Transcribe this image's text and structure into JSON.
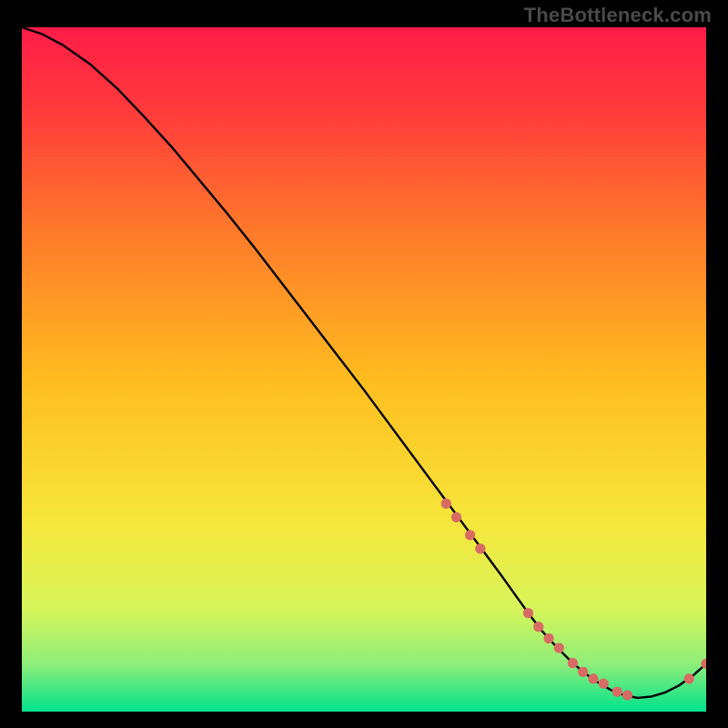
{
  "watermark": {
    "text": "TheBottleneck.com"
  },
  "chart_data": {
    "type": "line",
    "title": "",
    "xlabel": "",
    "ylabel": "",
    "xlim": [
      0,
      100
    ],
    "ylim": [
      0,
      100
    ],
    "grid": false,
    "legend": false,
    "background_gradient": {
      "top_color": "#ff1c48",
      "mid_color": "#ffbe1f",
      "bottom_color": "#00e28c"
    },
    "series": [
      {
        "name": "curve",
        "color": "#000000",
        "x": [
          0,
          3,
          6,
          10,
          14,
          18,
          22,
          26,
          30,
          34,
          38,
          42,
          46,
          50,
          54,
          58,
          62,
          66,
          70,
          72,
          74,
          76,
          78,
          80,
          82,
          84,
          86,
          88,
          90,
          92,
          94,
          96,
          98,
          100
        ],
        "y": [
          100,
          99.0,
          97.4,
          94.6,
          91.0,
          86.8,
          82.4,
          77.6,
          72.8,
          67.8,
          62.6,
          57.4,
          52.2,
          47.0,
          41.6,
          36.2,
          30.8,
          25.4,
          20.0,
          17.2,
          14.4,
          11.8,
          9.6,
          7.6,
          5.8,
          4.4,
          3.2,
          2.4,
          2.0,
          2.2,
          2.8,
          3.8,
          5.2,
          7.0
        ]
      }
    ],
    "markers": {
      "name": "highlight-points",
      "color": "#d86b63",
      "radius": 5.6,
      "x": [
        62,
        63.5,
        65.5,
        67,
        74,
        75.5,
        77,
        78.5,
        80.5,
        82,
        83.5,
        85,
        87,
        88.5,
        97.5,
        100
      ],
      "y": [
        30.4,
        28.4,
        25.8,
        23.8,
        14.4,
        12.4,
        10.7,
        9.3,
        7.1,
        5.8,
        4.8,
        4.1,
        2.9,
        2.4,
        4.8,
        7.0
      ]
    }
  }
}
